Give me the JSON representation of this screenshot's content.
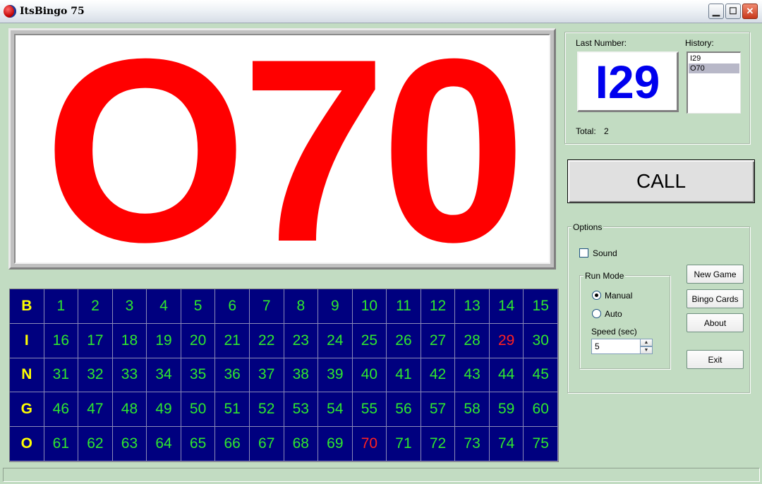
{
  "window": {
    "title": "ItsBingo 75",
    "controls": {
      "minimize": "▁",
      "maximize": "☐",
      "close": "✕"
    }
  },
  "display": {
    "current_call": "O70"
  },
  "board": {
    "letters": [
      "B",
      "I",
      "N",
      "G",
      "O"
    ],
    "rows": [
      [
        "1",
        "2",
        "3",
        "4",
        "5",
        "6",
        "7",
        "8",
        "9",
        "10",
        "11",
        "12",
        "13",
        "14",
        "15"
      ],
      [
        "16",
        "17",
        "18",
        "19",
        "20",
        "21",
        "22",
        "23",
        "24",
        "25",
        "26",
        "27",
        "28",
        "29",
        "30"
      ],
      [
        "31",
        "32",
        "33",
        "34",
        "35",
        "36",
        "37",
        "38",
        "39",
        "40",
        "41",
        "42",
        "43",
        "44",
        "45"
      ],
      [
        "46",
        "47",
        "48",
        "49",
        "50",
        "51",
        "52",
        "53",
        "54",
        "55",
        "56",
        "57",
        "58",
        "59",
        "60"
      ],
      [
        "61",
        "62",
        "63",
        "64",
        "65",
        "66",
        "67",
        "68",
        "69",
        "70",
        "71",
        "72",
        "73",
        "74",
        "75"
      ]
    ],
    "called": [
      "29",
      "70"
    ]
  },
  "info": {
    "last_number_label": "Last Number:",
    "last_number": "I29",
    "history_label": "History:",
    "history": [
      "I29",
      "O70"
    ],
    "history_selected": 1,
    "total_label": "Total:",
    "total": "2"
  },
  "call_button": "CALL",
  "options": {
    "title": "Options",
    "sound_label": "Sound",
    "sound_checked": false,
    "run_mode_title": "Run Mode",
    "manual_label": "Manual",
    "auto_label": "Auto",
    "selected_mode": "Manual",
    "speed_label": "Speed (sec)",
    "speed_value": "5",
    "buttons": {
      "new_game": "New Game",
      "bingo_cards": "Bingo Cards",
      "about": "About",
      "exit": "Exit"
    }
  },
  "colors": {
    "background": "#c2dcc2",
    "big_number": "#ff0000",
    "last_number": "#0000ee",
    "board_bg": "#00007f",
    "board_number": "#2ee82e",
    "board_letter": "#ffff00",
    "board_called": "#ff2020"
  }
}
